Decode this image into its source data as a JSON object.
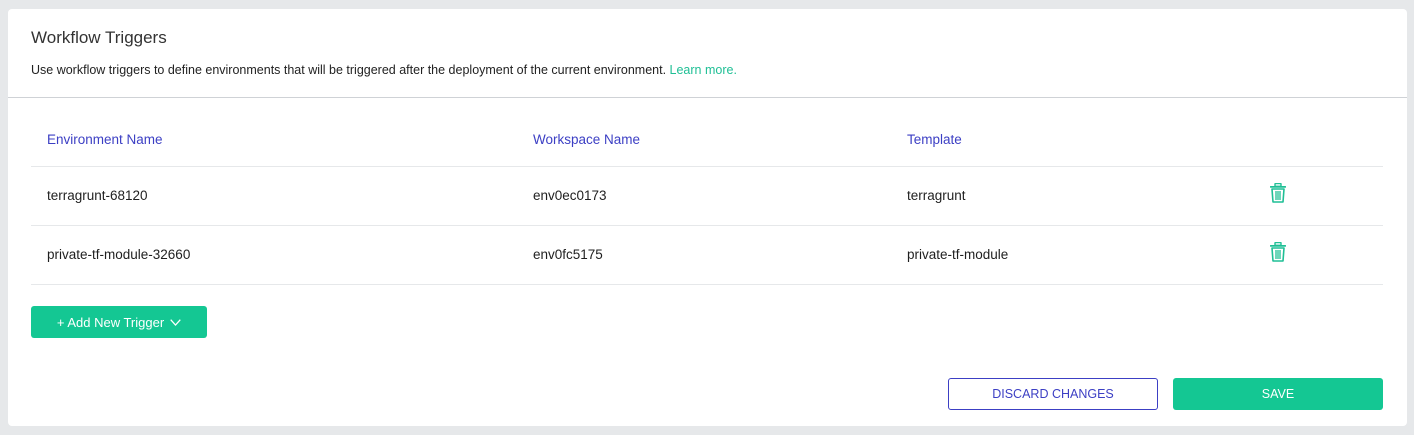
{
  "panel": {
    "title": "Workflow Triggers",
    "description": "Use workflow triggers to define environments that will be triggered after the deployment of the current environment.",
    "learn_more": "Learn more."
  },
  "table": {
    "headers": {
      "environment": "Environment Name",
      "workspace": "Workspace Name",
      "template": "Template"
    },
    "rows": [
      {
        "environment": "terragrunt-68120",
        "workspace": "env0ec0173",
        "template": "terragrunt",
        "action_icon": "trash-icon"
      },
      {
        "environment": "private-tf-module-32660",
        "workspace": "env0fc5175",
        "template": "private-tf-module",
        "action_icon": "trash-icon"
      }
    ]
  },
  "actions": {
    "add_trigger": "+ Add New Trigger",
    "add_trigger_icon": "chevron-down-icon",
    "discard": "DISCARD CHANGES",
    "save": "SAVE"
  },
  "colors": {
    "accent_green": "#14c793",
    "link_green": "#1fbf95",
    "header_blue": "#3c3fc4"
  }
}
